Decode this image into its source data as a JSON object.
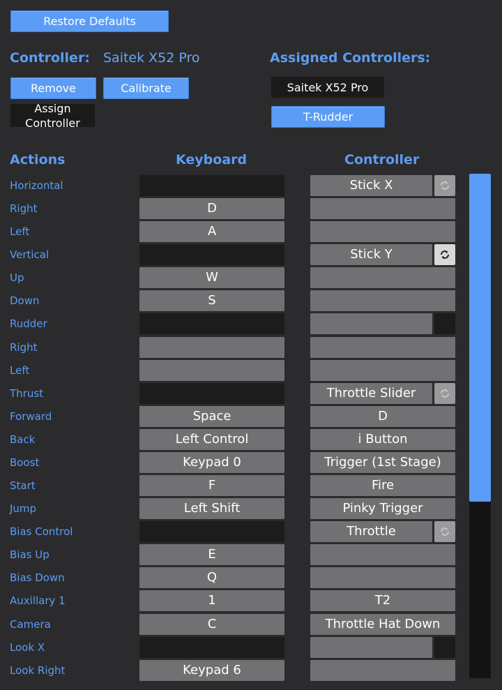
{
  "restore_defaults": "Restore Defaults",
  "controller_label": "Controller:",
  "controller_name": "Saitek X52 Pro",
  "remove_label": "Remove",
  "calibrate_label": "Calibrate",
  "assign_controller_label": "Assign Controller",
  "assigned_label": "Assigned Controllers:",
  "assigned_controllers": [
    "Saitek X52 Pro",
    "T-Rudder"
  ],
  "columns": {
    "actions": "Actions",
    "keyboard": "Keyboard",
    "controller": "Controller"
  },
  "rows": [
    {
      "action": "Horizontal",
      "keyboard": "",
      "controller": "Stick X"
    },
    {
      "action": "Right",
      "keyboard": "D",
      "controller": ""
    },
    {
      "action": "Left",
      "keyboard": "A",
      "controller": ""
    },
    {
      "action": "Vertical",
      "keyboard": "",
      "controller": "Stick Y"
    },
    {
      "action": "Up",
      "keyboard": "W",
      "controller": ""
    },
    {
      "action": "Down",
      "keyboard": "S",
      "controller": ""
    },
    {
      "action": "Rudder",
      "keyboard": "",
      "controller": ""
    },
    {
      "action": "Right",
      "keyboard": "",
      "controller": ""
    },
    {
      "action": "Left",
      "keyboard": "",
      "controller": ""
    },
    {
      "action": "Thrust",
      "keyboard": "",
      "controller": "Throttle Slider"
    },
    {
      "action": "Forward",
      "keyboard": "Space",
      "controller": "D"
    },
    {
      "action": "Back",
      "keyboard": "Left Control",
      "controller": "i Button"
    },
    {
      "action": "Boost",
      "keyboard": "Keypad 0",
      "controller": "Trigger (1st Stage)"
    },
    {
      "action": "Start",
      "keyboard": "F",
      "controller": "Fire"
    },
    {
      "action": "Jump",
      "keyboard": "Left Shift",
      "controller": "Pinky Trigger"
    },
    {
      "action": "Bias Control",
      "keyboard": "",
      "controller": "Throttle"
    },
    {
      "action": "Bias Up",
      "keyboard": "E",
      "controller": ""
    },
    {
      "action": "Bias Down",
      "keyboard": "Q",
      "controller": ""
    },
    {
      "action": "Auxillary 1",
      "keyboard": "1",
      "controller": "T2"
    },
    {
      "action": "Camera",
      "keyboard": "C",
      "controller": "Throttle Hat Down"
    },
    {
      "action": "Look X",
      "keyboard": "",
      "controller": ""
    },
    {
      "action": "Look Right",
      "keyboard": "Keypad 6",
      "controller": ""
    }
  ],
  "colors": {
    "accent": "#5b9cf6",
    "background": "#2b2b2d",
    "cell": "#717173",
    "dark_cell": "#1c1c1d"
  },
  "icons": {
    "axis_invert": "refresh-icon"
  }
}
